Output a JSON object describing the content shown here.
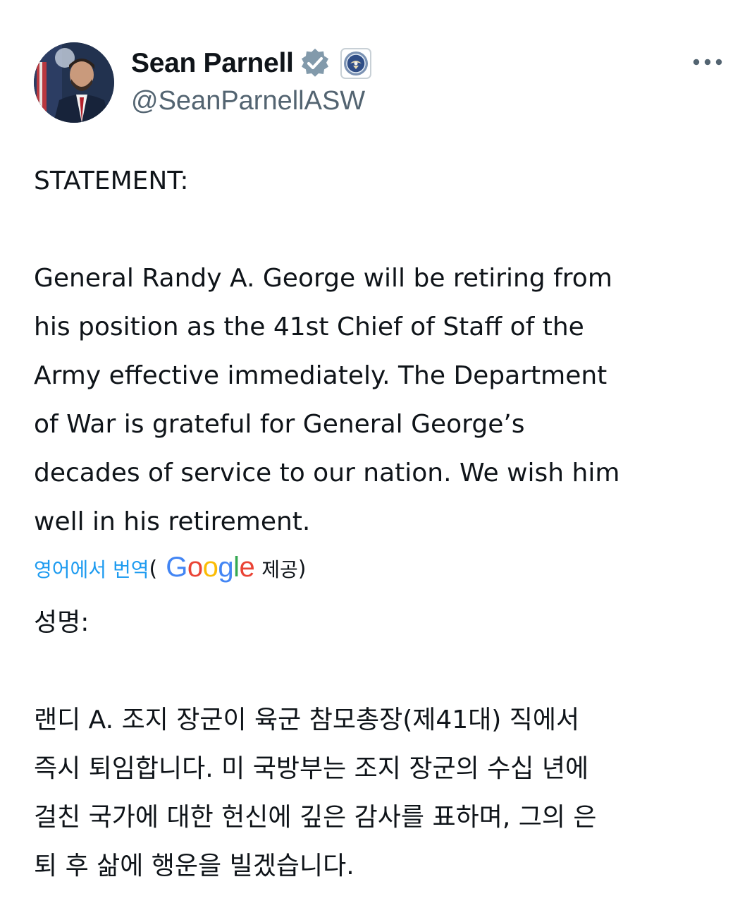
{
  "author": {
    "display_name": "Sean Parnell",
    "handle": "@SeanParnellASW",
    "verified_icon": "verified-badge-icon",
    "affiliate_badge_icon": "department-seal-icon",
    "avatar": "profile-photo"
  },
  "menu": {
    "more_icon": "more-horizontal-icon"
  },
  "post": {
    "lines_1": [
      "STATEMENT:"
    ],
    "lines_2": [
      "General Randy A. George will be retiring from",
      "his position as the 41st Chief of Staff of the",
      "Army effective immediately. The Department",
      "of War is grateful for General George’s",
      "decades of service to our nation. We wish him",
      "well in his retirement."
    ]
  },
  "translation": {
    "link_label": "영어에서 번역",
    "paren_open": "(",
    "provider_logo": "Google",
    "provider_suffix": "제공",
    "paren_close": ")",
    "lines_1": [
      "성명:"
    ],
    "lines_2": [
      "랜디 A. 조지 장군이 육군 참모총장(제41대) 직에서",
      "즉시 퇴임합니다. 미 국방부는 조지 장군의 수십 년에",
      "걸친 국가에 대한 헌신에 깊은 감사를 표하며, 그의 은",
      "퇴 후 삶에 행운을 빌겠습니다."
    ]
  },
  "colors": {
    "text": "#0f1419",
    "secondary": "#536471",
    "link": "#1d9bf0",
    "verified": "#829aab",
    "google_blue": "#4285f4",
    "google_red": "#ea4335",
    "google_yellow": "#fbbc05",
    "google_green": "#34a853"
  }
}
